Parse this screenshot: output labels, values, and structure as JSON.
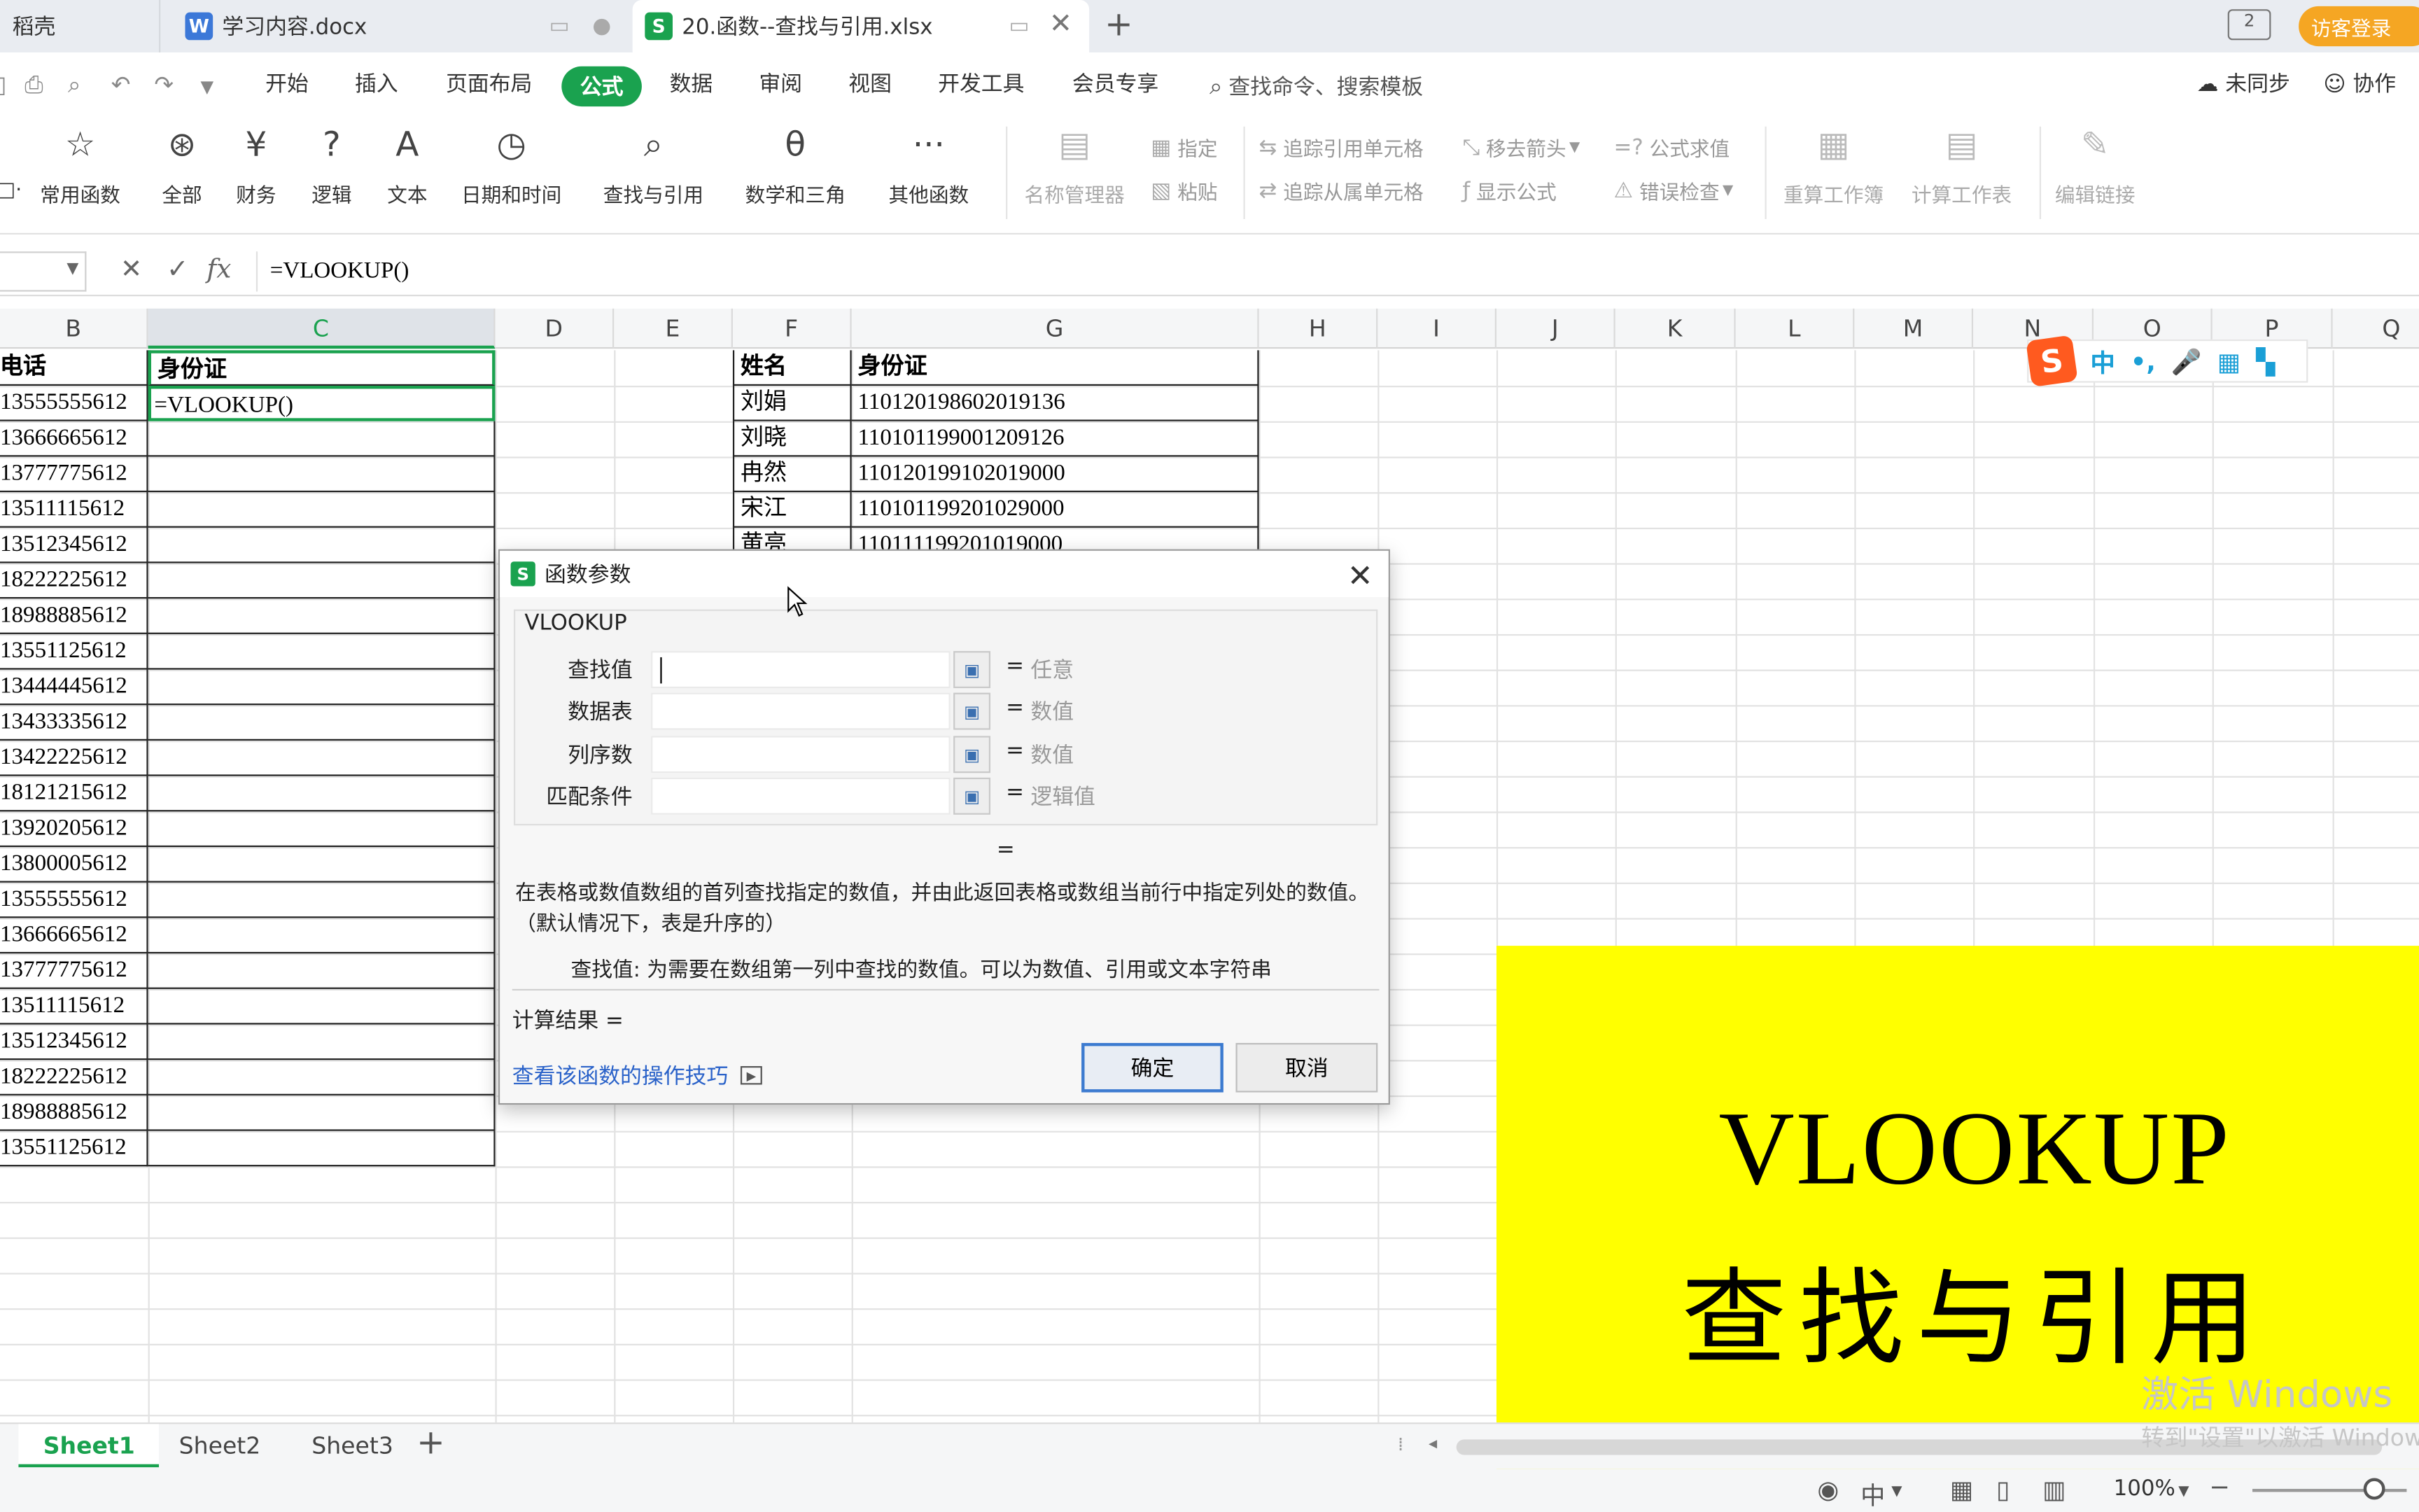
{
  "tabs": {
    "prev_label": "稻壳",
    "docx_label": "学习内容.docx",
    "xlsx_label": "20.函数--查找与引用.xlsx",
    "add": "+",
    "login": "访客登录",
    "window_badge": "2"
  },
  "menu": {
    "items": [
      "开始",
      "插入",
      "页面布局",
      "公式",
      "数据",
      "审阅",
      "视图",
      "开发工具",
      "会员专享"
    ],
    "active": "公式",
    "search": "查找命令、搜索模板",
    "sync": "未同步",
    "collab": "协作"
  },
  "ribbon": {
    "buttons": [
      "常用函数",
      "全部",
      "财务",
      "逻辑",
      "文本",
      "日期和时间",
      "查找与引用",
      "数学和三角",
      "其他函数"
    ],
    "name_mgr": "名称管理器",
    "define": "指定",
    "paste": "粘贴",
    "trace_prec": "追踪引用单元格",
    "trace_dep": "追踪从属单元格",
    "remove_arrows": "移去箭头",
    "show_formula": "显示公式",
    "eval_formula": "公式求值",
    "error_check": "错误检查",
    "recalc_wb": "重算工作簿",
    "calc_sheet": "计算工作表",
    "edit_links": "编辑链接"
  },
  "formula_bar": {
    "formula": "=VLOOKUP()"
  },
  "columns": [
    "B",
    "C",
    "D",
    "E",
    "F",
    "G",
    "H",
    "I",
    "J",
    "K",
    "L",
    "M",
    "N",
    "O",
    "P",
    "Q"
  ],
  "table1": {
    "header_b": "电话",
    "header_c": "身份证",
    "c_first": "=VLOOKUP()",
    "phones": [
      "13555555612",
      "13666665612",
      "13777775612",
      "13511115612",
      "13512345612",
      "18222225612",
      "18988885612",
      "13551125612",
      "13444445612",
      "13433335612",
      "13422225612",
      "18121215612",
      "13920205612",
      "13800005612",
      "13555555612",
      "13666665612",
      "13777775612",
      "13511115612",
      "13512345612",
      "18222225612",
      "18988885612",
      "13551125612"
    ]
  },
  "table2": {
    "header_f": "姓名",
    "header_g": "身份证",
    "rows": [
      {
        "name": "刘娟",
        "id": "110120198602019136"
      },
      {
        "name": "刘晓",
        "id": "110101199001209126"
      },
      {
        "name": "冉然",
        "id": "110120199102019000"
      },
      {
        "name": "宋江",
        "id": "110101199201029000"
      },
      {
        "name": "黄亮",
        "id": "110111199201019000"
      }
    ]
  },
  "banner": {
    "title": "VLOOKUP",
    "subtitle": "查找与引用"
  },
  "dialog": {
    "title": "函数参数",
    "function": "VLOOKUP",
    "args": [
      {
        "label": "查找值",
        "hint": "任意"
      },
      {
        "label": "数据表",
        "hint": "数值"
      },
      {
        "label": "列序数",
        "hint": "数值"
      },
      {
        "label": "匹配条件",
        "hint": "逻辑值"
      }
    ],
    "equals": "=",
    "description": "在表格或数值数组的首列查找指定的数值，并由此返回表格或数组当前行中指定列处的数值。（默认情况下，表是升序的）",
    "arg_help": "查找值:  为需要在数组第一列中查找的数值。可以为数值、引用或文本字符串",
    "result_label": "计算结果 =",
    "help_link": "查看该函数的操作技巧",
    "ok": "确定",
    "cancel": "取消"
  },
  "sheets": [
    "Sheet1",
    "Sheet2",
    "Sheet3"
  ],
  "status": {
    "zoom": "100%"
  },
  "watermark": {
    "line1": "激活 Windows",
    "line2": "转到\"设置\"以激活 Windows。"
  },
  "colors": {
    "accent_green": "#1aa24f",
    "banner_yellow": "#ffff00",
    "login_orange": "#f5a623"
  }
}
